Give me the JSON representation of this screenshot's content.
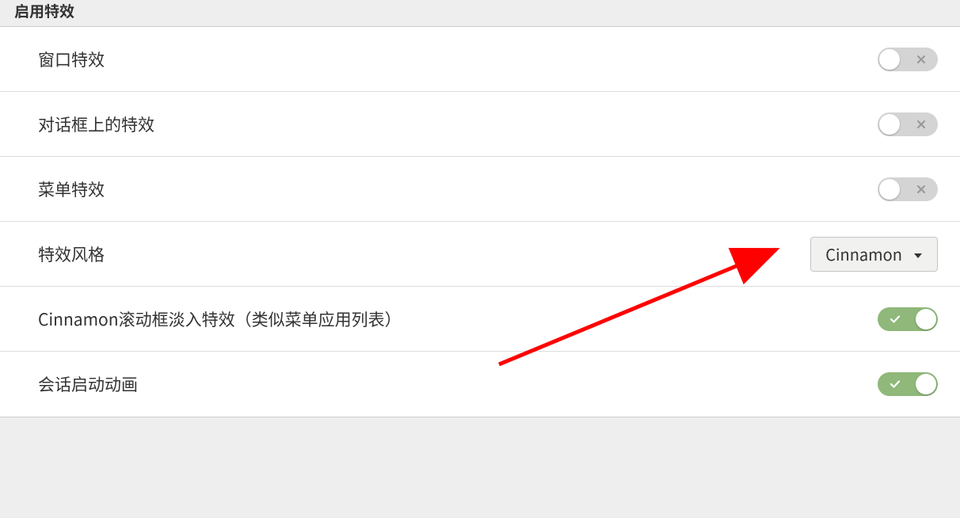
{
  "section": {
    "title": "启用特效"
  },
  "rows": {
    "window_effects": {
      "label": "窗口特效",
      "enabled": false
    },
    "dialog_effects": {
      "label": "对话框上的特效",
      "enabled": false
    },
    "menu_effects": {
      "label": "菜单特效",
      "enabled": false
    },
    "effect_style": {
      "label": "特效风格",
      "selected": "Cinnamon"
    },
    "overlay_fade": {
      "label": "Cinnamon滚动框淡入特效（类似菜单应用列表）",
      "enabled": true
    },
    "session_anim": {
      "label": "会话启动动画",
      "enabled": true
    }
  }
}
